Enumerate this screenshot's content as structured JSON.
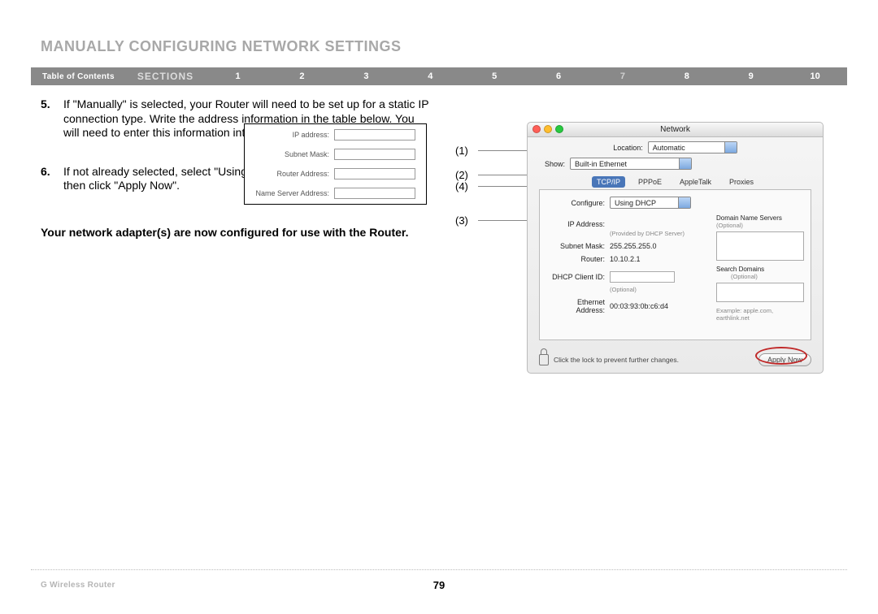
{
  "header": {
    "title": "MANUALLY CONFIGURING NETWORK SETTINGS"
  },
  "nav": {
    "toc": "Table of Contents",
    "sections_label": "SECTIONS",
    "numbers": [
      "1",
      "2",
      "3",
      "4",
      "5",
      "6",
      "7",
      "8",
      "9",
      "10"
    ],
    "active": "7"
  },
  "steps": {
    "s5_num": "5.",
    "s5_text": "If \"Manually\" is selected, your Router will need to be set up for a static IP connection type. Write the address information in the table below. You will need to enter this information into the Router.",
    "s6_num": "6.",
    "s6_text_a": "If not already selected, select \"Using DHCP\" next to \"Configure:\" ",
    "s6_text_b": "(3)",
    "s6_text_c": ", then click \"Apply Now\".",
    "conclusion": "Your network adapter(s) are now configured for use with the Router."
  },
  "ipbox": {
    "ip_label": "IP address:",
    "mask_label": "Subnet Mask:",
    "router_label": "Router Address:",
    "ns_label": "Name Server Address:"
  },
  "callouts": {
    "c1": "(1)",
    "c2": "(2)",
    "c4": "(4)",
    "c3": "(3)"
  },
  "mac": {
    "title": "Network",
    "location_label": "Location:",
    "location_value": "Automatic",
    "show_label": "Show:",
    "show_value": "Built-in Ethernet",
    "tabs": {
      "tcpip": "TCP/IP",
      "pppoe": "PPPoE",
      "appletalk": "AppleTalk",
      "proxies": "Proxies"
    },
    "configure_label": "Configure:",
    "configure_value": "Using DHCP",
    "ip_label": "IP Address:",
    "ip_note": "(Provided by DHCP Server)",
    "mask_label": "Subnet Mask:",
    "mask_value": "255.255.255.0",
    "router_label": "Router:",
    "router_value": "10.10.2.1",
    "client_label": "DHCP Client ID:",
    "client_note": "(Optional)",
    "eth_label": "Ethernet Address:",
    "eth_value": "00:03:93:0b:c6:d4",
    "dns_header": "Domain Name Servers",
    "optional": "(Optional)",
    "search_header": "Search Domains",
    "example": "Example: apple.com, earthlink.net",
    "lock_text": "Click the lock to prevent further changes.",
    "apply": "Apply Now"
  },
  "footer": {
    "product": "G Wireless Router",
    "page": "79"
  }
}
